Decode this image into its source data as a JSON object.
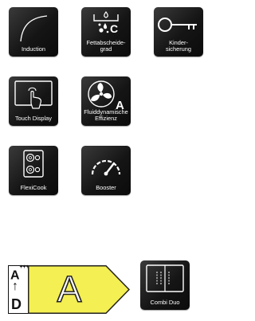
{
  "features": [
    {
      "id": "induction",
      "label": [
        "Induction"
      ],
      "icon": "induction-curve-icon"
    },
    {
      "id": "fettabscheidegrad",
      "label": [
        "Fettabscheide-",
        "grad"
      ],
      "icon": "grease-filter-icon"
    },
    {
      "id": "kindersicherung",
      "label": [
        "Kinder-",
        "sicherung"
      ],
      "icon": "key-icon"
    },
    {
      "id": "touch-display",
      "label": [
        "Touch Display"
      ],
      "icon": "touch-display-icon"
    },
    {
      "id": "fluiddynamische-effizienz",
      "label": [
        "Fluiddynamische",
        "Effizienz"
      ],
      "icon": "fan-icon",
      "badge": "A"
    },
    {
      "id": "flexicook",
      "label": [
        "FlexiCook"
      ],
      "icon": "flexicook-zones-icon"
    },
    {
      "id": "booster",
      "label": [
        "Booster"
      ],
      "icon": "gauge-icon"
    },
    {
      "id": "combi-duo",
      "label": [
        "Combi Duo"
      ],
      "icon": "combi-duo-icon"
    }
  ],
  "energy_label": {
    "scale_top": "A",
    "scale_top_sup": "+++",
    "scale_arrow": "↑",
    "scale_bottom": "D",
    "rating": "A",
    "rating_color": "#f4ef52"
  },
  "colors": {
    "tile_dark": "#151515",
    "text_on_tile": "#ffffff"
  }
}
